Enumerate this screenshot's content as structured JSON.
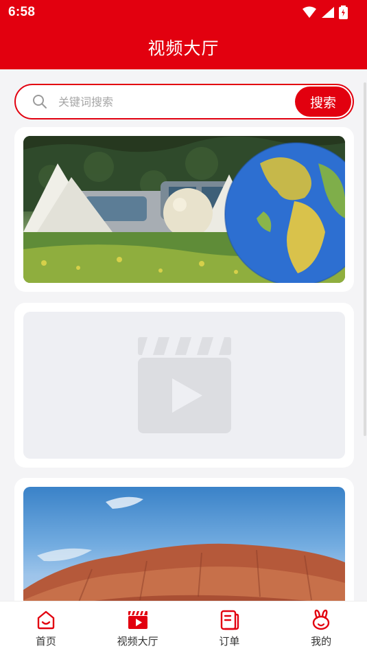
{
  "status_bar": {
    "time": "6:58"
  },
  "header": {
    "title": "视频大厅"
  },
  "search": {
    "placeholder": "关键词搜索",
    "button_label": "搜索"
  },
  "videos": [
    {
      "kind": "image"
    },
    {
      "kind": "placeholder"
    },
    {
      "kind": "image"
    }
  ],
  "tab_bar": {
    "tabs": [
      {
        "label": "首页",
        "icon": "home-icon"
      },
      {
        "label": "视频大厅",
        "icon": "video-icon"
      },
      {
        "label": "订单",
        "icon": "order-icon"
      },
      {
        "label": "我的",
        "icon": "rabbit-icon"
      }
    ]
  },
  "colors": {
    "brand": "#e2000f",
    "background": "#f4f4f6"
  }
}
